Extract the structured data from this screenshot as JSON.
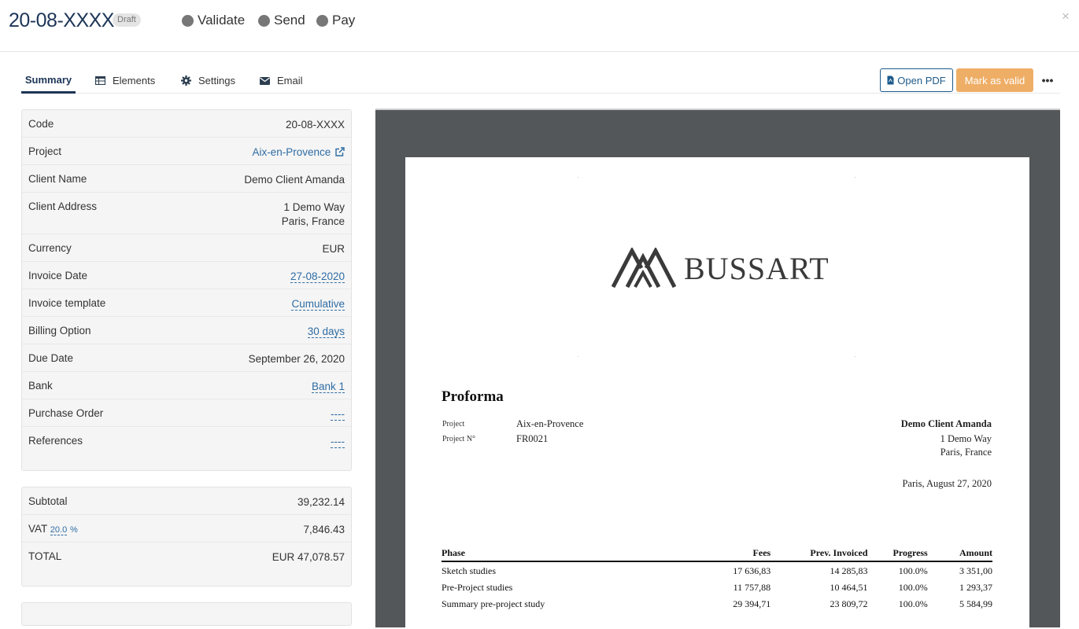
{
  "header": {
    "code": "20-08-XXXX",
    "badge": "Draft",
    "steps": [
      "Validate",
      "Send",
      "Pay"
    ],
    "close": "×"
  },
  "tabs": [
    {
      "label": "Summary",
      "icon": "summary"
    },
    {
      "label": "Elements",
      "icon": "table-icon"
    },
    {
      "label": "Settings",
      "icon": "gear-icon"
    },
    {
      "label": "Email",
      "icon": "envelope-icon"
    }
  ],
  "actions": {
    "open_pdf": "Open PDF",
    "mark_valid": "Mark as valid",
    "more": "•••"
  },
  "details": {
    "code_label": "Code",
    "code_value": "20-08-XXXX",
    "project_label": "Project",
    "project_value": "Aix-en-Provence",
    "client_label": "Client Name",
    "client_value": "Demo Client Amanda",
    "address_label": "Client Address",
    "address_line1": "1 Demo Way",
    "address_line2": "Paris, France",
    "currency_label": "Currency",
    "currency_value": "EUR",
    "date_label": "Invoice Date",
    "date_value": "27-08-2020",
    "template_label": "Invoice template",
    "template_value": "Cumulative",
    "billing_label": "Billing Option",
    "billing_value": "30 days",
    "due_label": "Due Date",
    "due_value": "September 26, 2020",
    "bank_label": "Bank",
    "bank_value": "Bank 1",
    "po_label": "Purchase Order",
    "po_value": "----",
    "refs_label": "References",
    "refs_value": "----"
  },
  "totals": {
    "subtotal_label": "Subtotal",
    "subtotal_value": "39,232.14",
    "vat_label": "VAT",
    "vat_rate": "20.0",
    "vat_pct": "%",
    "vat_value": "7,846.43",
    "total_label": "TOTAL",
    "total_value": "EUR 47,078.57"
  },
  "pdf": {
    "logo_text": "BUSSART",
    "title": "Proforma",
    "project_label": "Project",
    "project_value": "Aix-en-Provence",
    "project_no_label": "Project N°",
    "project_no_value": "FR0021",
    "client_name": "Demo Client Amanda",
    "client_line1": "1 Demo Way",
    "client_line2": "Paris, France",
    "place_date": "Paris, August 27, 2020",
    "table_headers": [
      "Phase",
      "Fees",
      "Prev. Invoiced",
      "Progress",
      "Amount"
    ],
    "table_rows": [
      [
        "Sketch studies",
        "17 636,83",
        "14 285,83",
        "100.0%",
        "3 351,00"
      ],
      [
        "Pre-Project studies",
        "11 757,88",
        "10 464,51",
        "100.0%",
        "1 293,37"
      ],
      [
        "Summary pre-project study",
        "29 394,71",
        "23 809,72",
        "100.0%",
        "5 584,99"
      ]
    ]
  }
}
